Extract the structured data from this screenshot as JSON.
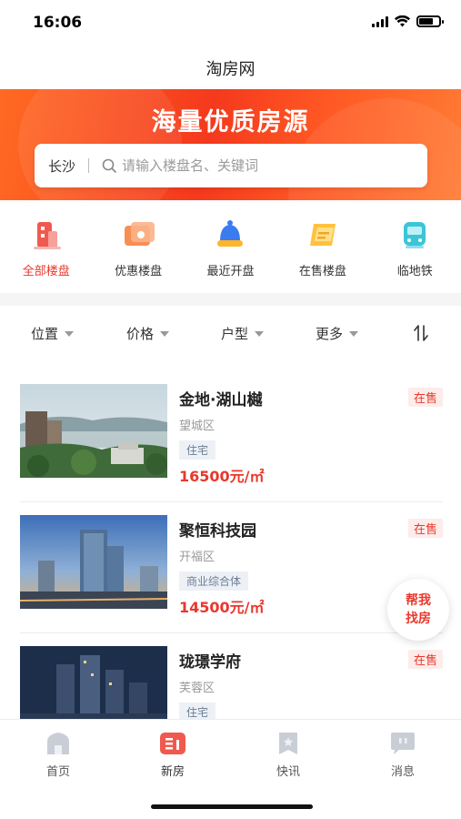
{
  "status": {
    "time": "16:06"
  },
  "nav": {
    "title": "淘房网"
  },
  "banner": {
    "title": "海量优质房源"
  },
  "search": {
    "city": "长沙",
    "placeholder": "请输入楼盘名、关键词"
  },
  "categories": [
    {
      "label": "全部楼盘",
      "icon": "building-icon",
      "active": true
    },
    {
      "label": "优惠楼盘",
      "icon": "discount-icon",
      "active": false
    },
    {
      "label": "最近开盘",
      "icon": "bell-icon",
      "active": false
    },
    {
      "label": "在售楼盘",
      "icon": "tag-icon",
      "active": false
    },
    {
      "label": "临地铁",
      "icon": "subway-icon",
      "active": false
    }
  ],
  "filters": [
    {
      "label": "位置"
    },
    {
      "label": "价格"
    },
    {
      "label": "户型"
    },
    {
      "label": "更多"
    }
  ],
  "listings": [
    {
      "name": "金地·湖山樾",
      "badge": "在售",
      "district": "望城区",
      "type": "住宅",
      "price": "16500元/㎡"
    },
    {
      "name": "聚恒科技园",
      "badge": "在售",
      "district": "开福区",
      "type": "商业综合体",
      "price": "14500元/㎡"
    },
    {
      "name": "珑璟学府",
      "badge": "在售",
      "district": "芙蓉区",
      "type": "住宅",
      "price": ""
    }
  ],
  "float_button": {
    "line1": "帮我",
    "line2": "找房"
  },
  "tabbar": [
    {
      "label": "首页",
      "icon": "home-icon"
    },
    {
      "label": "新房",
      "icon": "new-house-icon",
      "active": true
    },
    {
      "label": "快讯",
      "icon": "news-icon"
    },
    {
      "label": "消息",
      "icon": "message-icon"
    }
  ],
  "colors": {
    "accent": "#e8382c",
    "banner": "#f5391d"
  }
}
